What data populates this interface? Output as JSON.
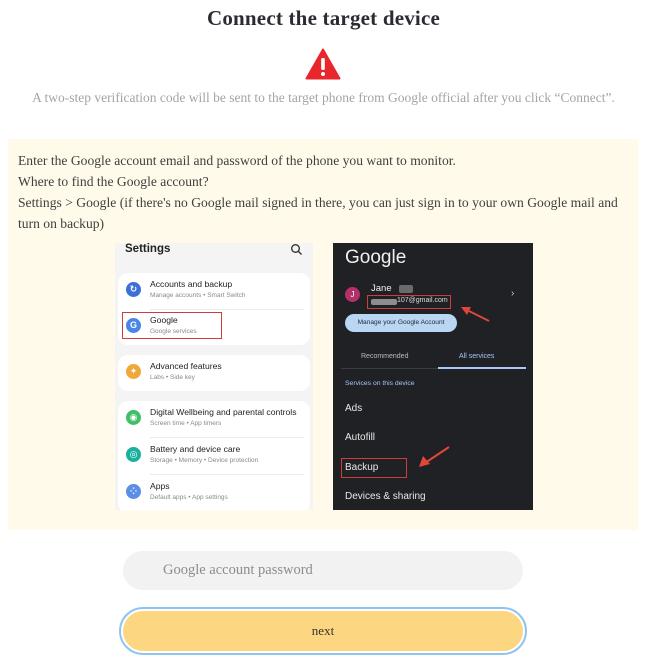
{
  "page": {
    "title": "Connect the target device",
    "warning_icon": "warning-triangle-icon",
    "note": "A two-step verification code will be sent to the target phone from Google official after you click “Connect”."
  },
  "instructions": {
    "line1": "Enter the Google account email and password of the phone you want to monitor.",
    "line2": "Where to find the Google account?",
    "line3": "Settings > Google (if there's no Google mail signed in there, you can just sign in to your own Google mail and turn on backup)"
  },
  "settings_screen": {
    "title": "Settings",
    "search_icon": "search-icon",
    "items": [
      {
        "name": "Accounts and backup",
        "sub": "Manage accounts  •  Smart Switch",
        "icon": "sync-icon",
        "color": "#3d6fd8"
      },
      {
        "name": "Google",
        "sub": "Google services",
        "icon": "google-icon",
        "color": "#4a86e8"
      },
      {
        "name": "Advanced features",
        "sub": "Labs  •  Side key",
        "icon": "gear-icon",
        "color": "#f0a83a"
      },
      {
        "name": "Digital Wellbeing and parental controls",
        "sub": "Screen time  •  App timers",
        "icon": "wellbeing-icon",
        "color": "#3fbf6a"
      },
      {
        "name": "Battery and device care",
        "sub": "Storage  •  Memory  •  Device protection",
        "icon": "battery-icon",
        "color": "#1ab0a0"
      },
      {
        "name": "Apps",
        "sub": "Default apps  •  App settings",
        "icon": "apps-icon",
        "color": "#5a8ee8"
      }
    ]
  },
  "google_screen": {
    "title": "Google",
    "avatar_letter": "J",
    "account_name": "Jane",
    "account_email_visible": "107@gmail.com",
    "manage_button": "Manage your Google Account",
    "tabs": [
      "Recommended",
      "All services"
    ],
    "section": "Services on this device",
    "items": [
      "Ads",
      "Autofill",
      "Backup",
      "Devices & sharing"
    ]
  },
  "form": {
    "password_placeholder": "Google account password",
    "next_label": "next"
  },
  "colors": {
    "accent_red": "#e8262b",
    "panel_bg": "#fffaea",
    "button_bg": "#fcd681",
    "button_ring": "#8fc4ef"
  }
}
